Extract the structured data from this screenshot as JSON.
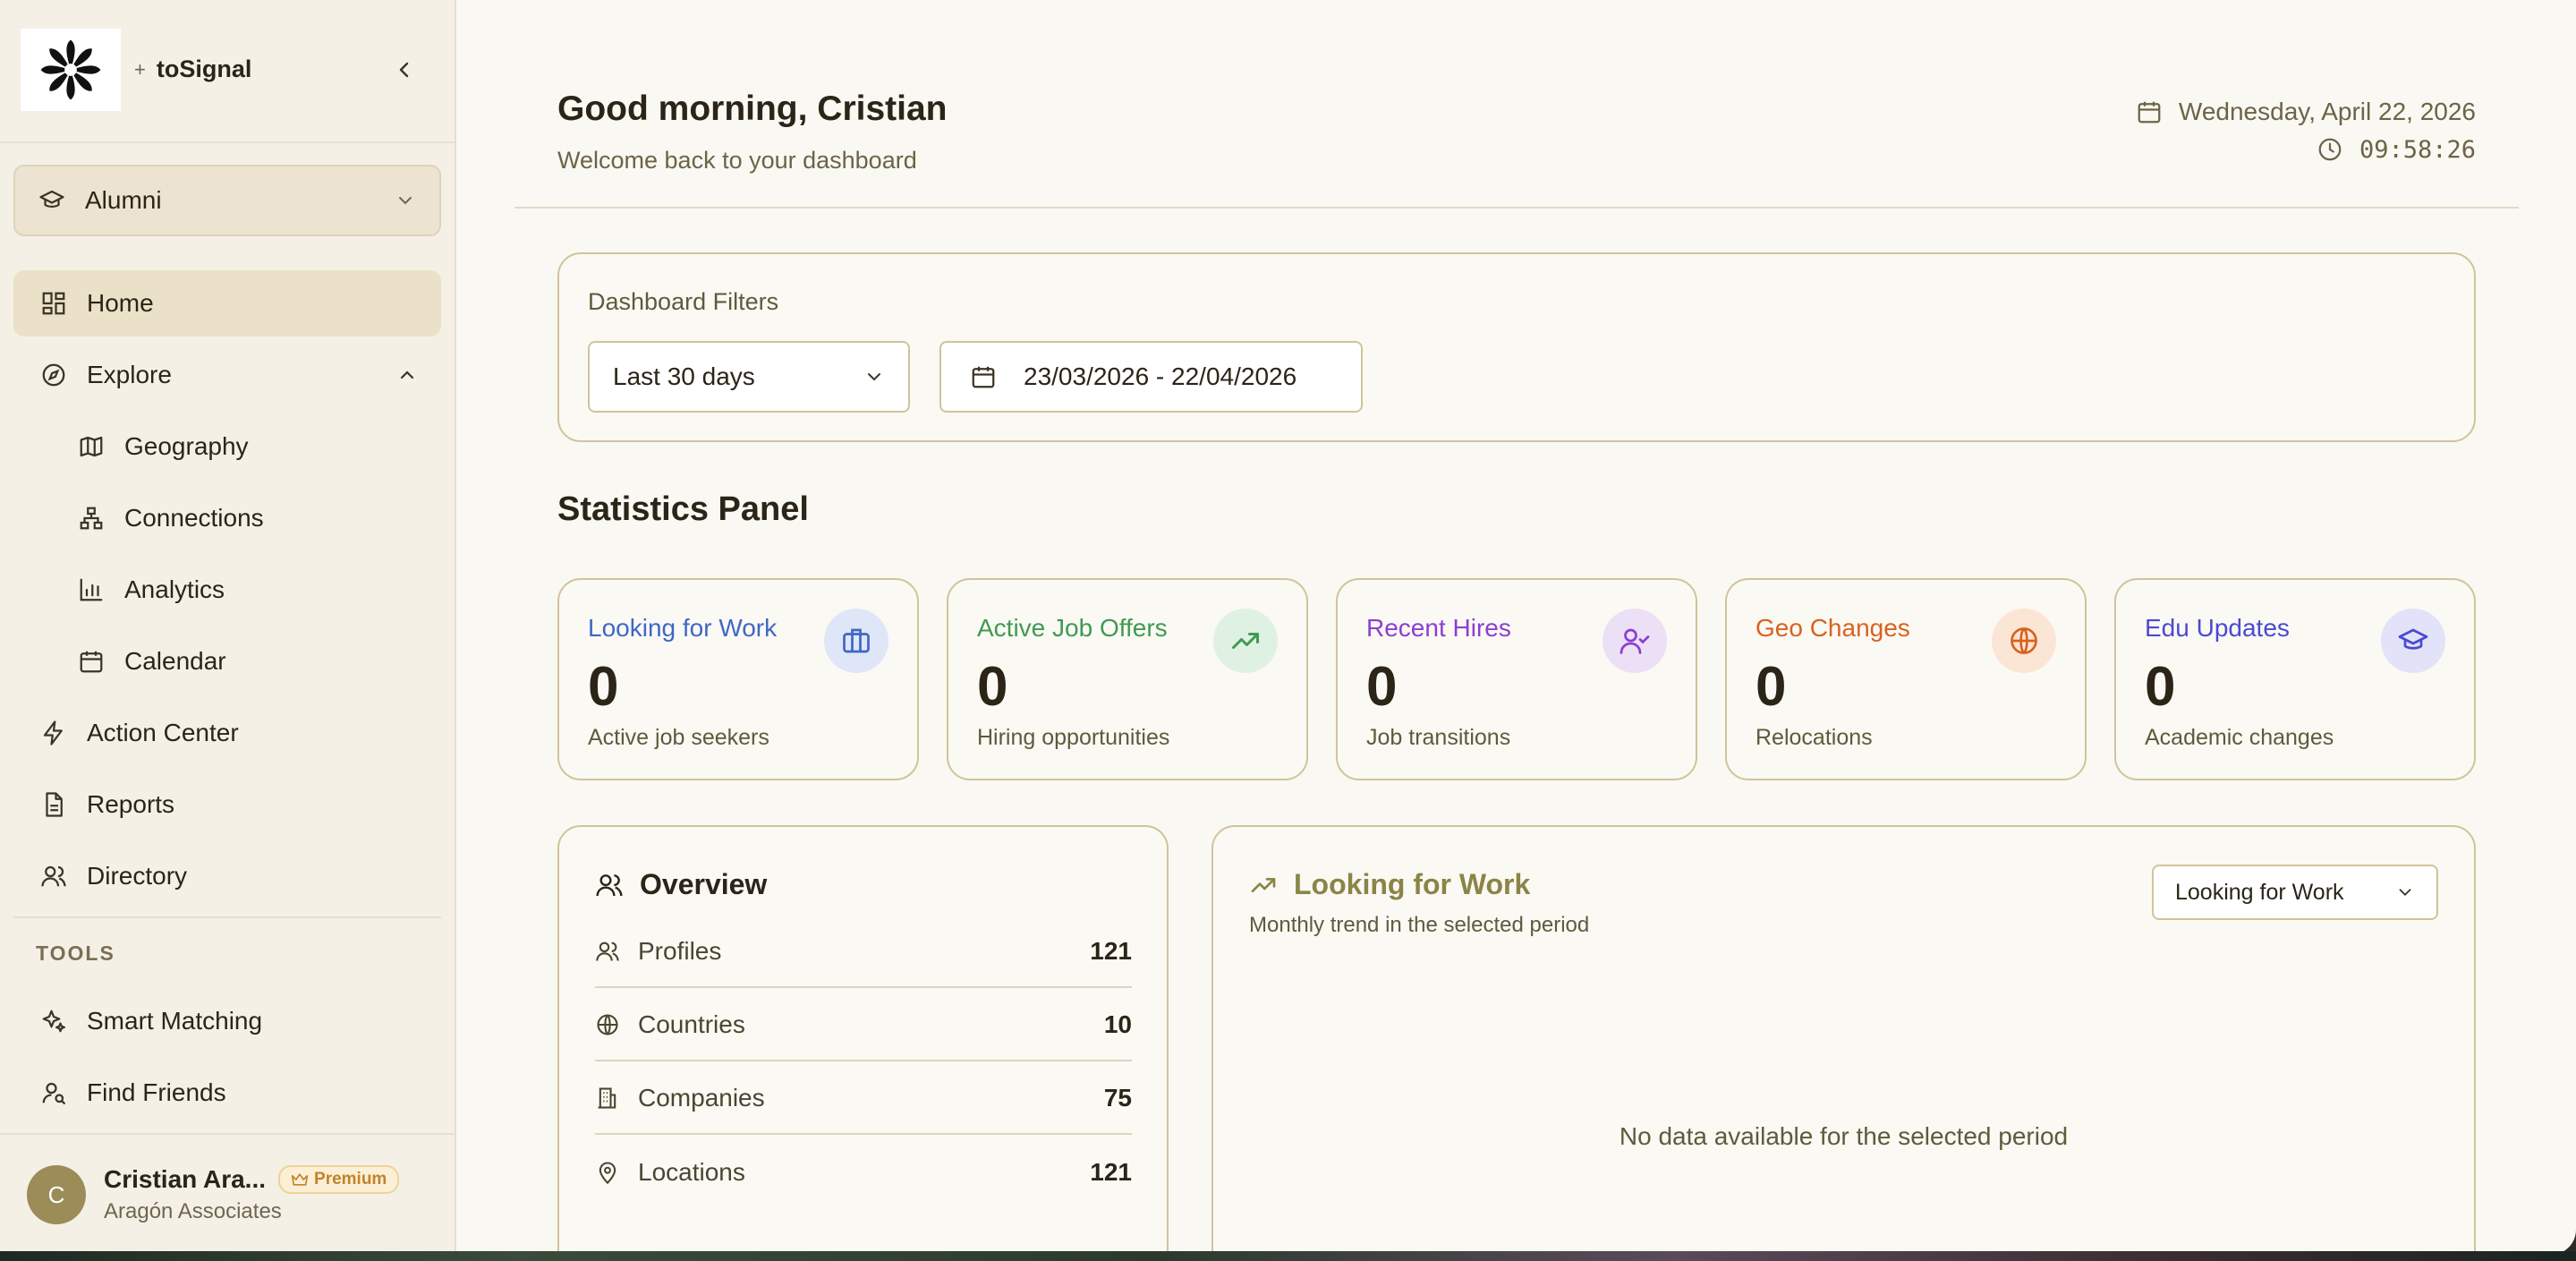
{
  "sidebar": {
    "brand_prefix": "+",
    "brand": "toSignal",
    "workspace_select": "Alumni",
    "nav": {
      "home": "Home",
      "explore": "Explore",
      "geography": "Geography",
      "connections": "Connections",
      "analytics": "Analytics",
      "calendar": "Calendar",
      "action_center": "Action Center",
      "reports": "Reports",
      "directory": "Directory"
    },
    "tools_label": "TOOLS",
    "tools": {
      "smart_matching": "Smart Matching",
      "find_friends": "Find Friends"
    },
    "user": {
      "initial": "C",
      "name": "Cristian Ara...",
      "badge": "Premium",
      "org": "Aragón Associates"
    }
  },
  "header": {
    "greeting": "Good morning, Cristian",
    "welcome": "Welcome back to your dashboard",
    "date": "Wednesday, April 22, 2026",
    "time": "09:58:26"
  },
  "filters": {
    "title": "Dashboard Filters",
    "period": "Last 30 days",
    "range": "23/03/2026 - 22/04/2026"
  },
  "stats": {
    "title": "Statistics Panel",
    "cards": [
      {
        "title": "Looking for Work",
        "value": "0",
        "sub": "Active job seekers",
        "color": "#3f67c4",
        "bg": "#dfe6f7"
      },
      {
        "title": "Active Job Offers",
        "value": "0",
        "sub": "Hiring opportunities",
        "color": "#3f9a52",
        "bg": "#dff1e2"
      },
      {
        "title": "Recent Hires",
        "value": "0",
        "sub": "Job transitions",
        "color": "#8b3fcf",
        "bg": "#ece0f7"
      },
      {
        "title": "Geo Changes",
        "value": "0",
        "sub": "Relocations",
        "color": "#d9621f",
        "bg": "#fbe6d6"
      },
      {
        "title": "Edu Updates",
        "value": "0",
        "sub": "Academic changes",
        "color": "#4a4ad1",
        "bg": "#e2e2f8"
      }
    ]
  },
  "overview": {
    "title": "Overview",
    "rows": [
      {
        "label": "Profiles",
        "value": "121"
      },
      {
        "label": "Countries",
        "value": "10"
      },
      {
        "label": "Companies",
        "value": "75"
      },
      {
        "label": "Locations",
        "value": "121"
      }
    ]
  },
  "trend": {
    "title": "Looking for Work",
    "subtitle": "Monthly trend in the selected period",
    "select": "Looking for Work",
    "empty": "No data available for the selected period"
  }
}
